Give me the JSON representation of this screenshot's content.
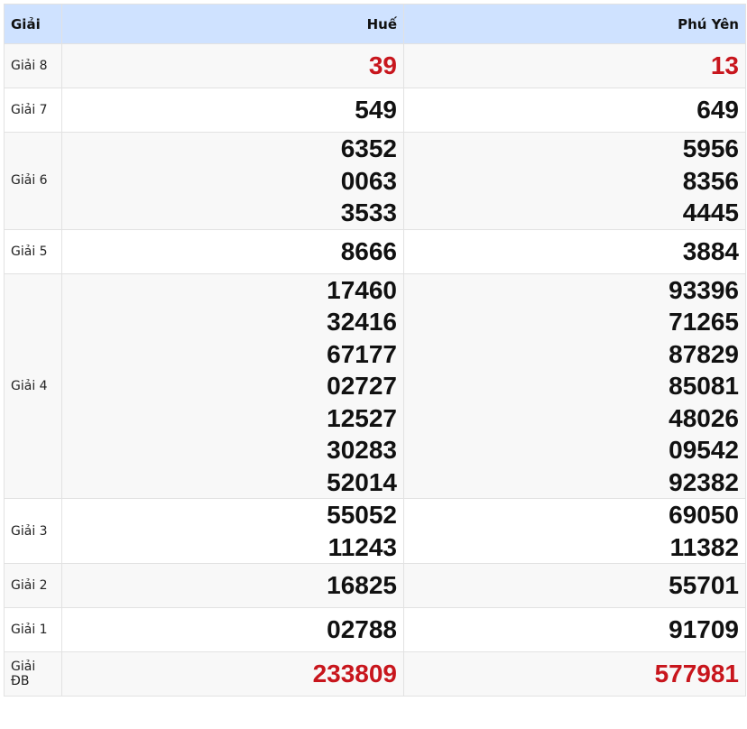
{
  "header": {
    "label": "Giải",
    "provinces": [
      "Huế",
      "Phú Yên"
    ]
  },
  "colors": {
    "header_bg": "#cfe2ff",
    "highlight": "#c8161d",
    "text": "#111111"
  },
  "rows": [
    {
      "name": "Giải 8",
      "highlight": true,
      "values": [
        [
          "39"
        ],
        [
          "13"
        ]
      ]
    },
    {
      "name": "Giải 7",
      "highlight": false,
      "values": [
        [
          "549"
        ],
        [
          "649"
        ]
      ]
    },
    {
      "name": "Giải 6",
      "highlight": false,
      "values": [
        [
          "6352",
          "0063",
          "3533"
        ],
        [
          "5956",
          "8356",
          "4445"
        ]
      ]
    },
    {
      "name": "Giải 5",
      "highlight": false,
      "values": [
        [
          "8666"
        ],
        [
          "3884"
        ]
      ]
    },
    {
      "name": "Giải 4",
      "highlight": false,
      "values": [
        [
          "17460",
          "32416",
          "67177",
          "02727",
          "12527",
          "30283",
          "52014"
        ],
        [
          "93396",
          "71265",
          "87829",
          "85081",
          "48026",
          "09542",
          "92382"
        ]
      ]
    },
    {
      "name": "Giải 3",
      "highlight": false,
      "values": [
        [
          "55052",
          "11243"
        ],
        [
          "69050",
          "11382"
        ]
      ]
    },
    {
      "name": "Giải 2",
      "highlight": false,
      "values": [
        [
          "16825"
        ],
        [
          "55701"
        ]
      ]
    },
    {
      "name": "Giải 1",
      "highlight": false,
      "values": [
        [
          "02788"
        ],
        [
          "91709"
        ]
      ]
    },
    {
      "name": "Giải ĐB",
      "highlight": true,
      "values": [
        [
          "233809"
        ],
        [
          "577981"
        ]
      ]
    }
  ]
}
